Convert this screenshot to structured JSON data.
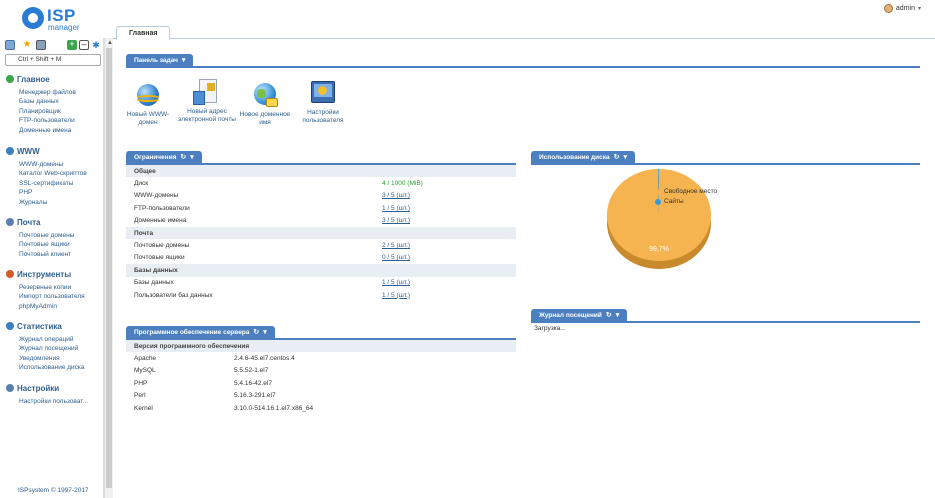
{
  "header": {
    "logo_text": "ISP",
    "logo_sub": "manager",
    "user": "admin"
  },
  "sidebar": {
    "search_placeholder": "Ctrl + Shift + M",
    "groups": [
      {
        "title": "Главное",
        "icon": "home-icon",
        "color": "#3aa54a",
        "items": [
          "Менеджер файлов",
          "Базы данных",
          "Планировщик",
          "FTP-пользователи",
          "Доменные имена"
        ]
      },
      {
        "title": "WWW",
        "icon": "globe-icon",
        "color": "#3a7fc0",
        "items": [
          "WWW-домены",
          "Каталог Web-скриптов",
          "SSL-сертификаты",
          "PHP",
          "Журналы"
        ]
      },
      {
        "title": "Почта",
        "icon": "mail-icon",
        "color": "#5a7fae",
        "items": [
          "Почтовые домены",
          "Почтовые ящики",
          "Почтовый клиент"
        ]
      },
      {
        "title": "Инструменты",
        "icon": "tools-icon",
        "color": "#d45a2a",
        "items": [
          "Резервные копии",
          "Импорт пользователя",
          "phpMyAdmin"
        ]
      },
      {
        "title": "Статистика",
        "icon": "stats-icon",
        "color": "#3a7fc0",
        "items": [
          "Журнал операций",
          "Журнал посещений",
          "Уведомления",
          "Использование диска"
        ]
      },
      {
        "title": "Настройки",
        "icon": "settings-icon",
        "color": "#5a7fae",
        "items": [
          "Настройки пользоват..."
        ]
      }
    ],
    "copyright": "ISPsystem © 1997-2017"
  },
  "main": {
    "tab": "Главная",
    "taskbar": {
      "title": "Панель задач",
      "icons": [
        {
          "label": "Новый WWW-домен",
          "icon": "globe-add-icon"
        },
        {
          "label": "Новый адрес электронной почты",
          "icon": "mail-add-icon"
        },
        {
          "label": "Новое доменное имя",
          "icon": "domain-add-icon"
        },
        {
          "label": "Настройки пользователя",
          "icon": "user-settings-icon"
        }
      ]
    },
    "limits": {
      "title": "Ограничения",
      "rows": [
        {
          "section": "Общее"
        },
        {
          "name": "Диск",
          "value": "4 / 1000 (MiB)",
          "link": false
        },
        {
          "name": "WWW-домены",
          "value": "3 / 5 (шт.)",
          "link": true
        },
        {
          "name": "FTP-пользователи",
          "value": "1 / 5 (шт.)",
          "link": true
        },
        {
          "name": "Доменные имена",
          "value": "3 / 5 (шт.)",
          "link": true
        },
        {
          "section": "Почта"
        },
        {
          "name": "Почтовые домены",
          "value": "2 / 5 (шт.)",
          "link": true
        },
        {
          "name": "Почтовые ящики",
          "value": "0 / 5 (шт.)",
          "link": true
        },
        {
          "section": "Базы данных"
        },
        {
          "name": "Базы данных",
          "value": "1 / 5 (шт.)",
          "link": true
        },
        {
          "name": "Пользователи баз данных",
          "value": "1 / 5 (шт.)",
          "link": true
        }
      ]
    },
    "software": {
      "title": "Программное обеспечение сервера",
      "header": "Версия программного обеспечения",
      "rows": [
        {
          "name": "Apache",
          "value": "2.4.6-45.el7.centos.4"
        },
        {
          "name": "MySQL",
          "value": "5.5.52-1.el7"
        },
        {
          "name": "PHP",
          "value": "5.4.16-42.el7"
        },
        {
          "name": "Perl",
          "value": "5.16.3-291.el7"
        },
        {
          "name": "Kernel",
          "value": "3.10.0-514.16.1.el7.x86_64"
        }
      ]
    },
    "disk_usage": {
      "title": "Использование диска",
      "legend": [
        "Свободное место",
        "Сайты"
      ]
    },
    "visits": {
      "title": "Журнал посещений",
      "status": "Загрузка..."
    }
  },
  "chart_data": {
    "type": "pie",
    "slices": [
      {
        "name": "Свободное место",
        "value": 99.7,
        "color": "#f5b44f"
      },
      {
        "name": "Сайты",
        "value": 0.3,
        "color": "#3a9ad9"
      }
    ],
    "labels": [
      "99,7%"
    ]
  }
}
